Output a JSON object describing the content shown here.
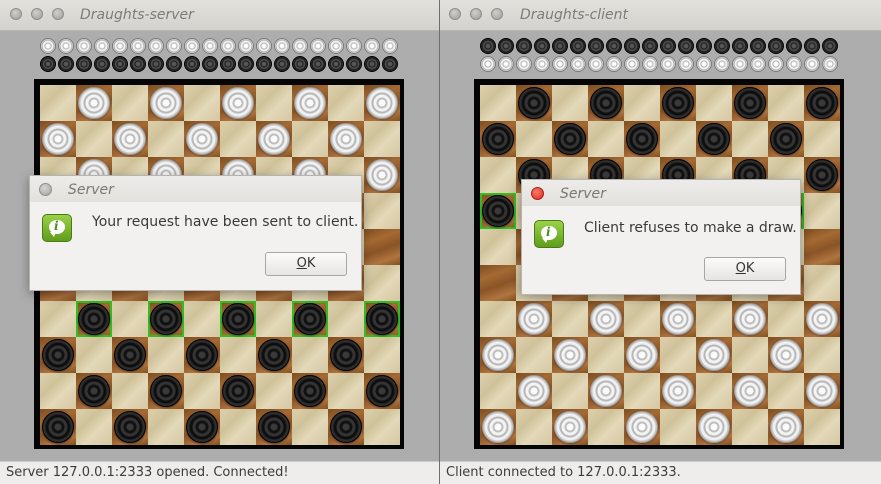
{
  "server_window": {
    "title": "Draughts-server",
    "status": "Server 127.0.0.1:2333 opened. Connected!",
    "captured_rows": [
      [
        "white",
        "white",
        "white",
        "white",
        "white",
        "white",
        "white",
        "white",
        "white",
        "white",
        "white",
        "white",
        "white",
        "white",
        "white",
        "white",
        "white",
        "white",
        "white",
        "white"
      ],
      [
        "black",
        "black",
        "black",
        "black",
        "black",
        "black",
        "black",
        "black",
        "black",
        "black",
        "black",
        "black",
        "black",
        "black",
        "black",
        "black",
        "black",
        "black",
        "black",
        "black"
      ]
    ],
    "board": {
      "pieces": [
        [
          null,
          "white",
          null,
          "white",
          null,
          "white",
          null,
          "white",
          null,
          "white"
        ],
        [
          "white",
          null,
          "white",
          null,
          "white",
          null,
          "white",
          null,
          "white",
          null
        ],
        [
          null,
          "white",
          null,
          "white",
          null,
          "white",
          null,
          "white",
          null,
          "white"
        ],
        [
          null,
          null,
          null,
          null,
          null,
          null,
          null,
          null,
          null,
          null
        ],
        [
          null,
          null,
          null,
          null,
          null,
          null,
          null,
          null,
          null,
          null
        ],
        [
          null,
          null,
          null,
          null,
          null,
          null,
          null,
          null,
          null,
          null
        ],
        [
          null,
          "black",
          null,
          "black",
          null,
          "black",
          null,
          "black",
          null,
          "black"
        ],
        [
          "black",
          null,
          "black",
          null,
          "black",
          null,
          "black",
          null,
          "black",
          null
        ],
        [
          null,
          "black",
          null,
          "black",
          null,
          "black",
          null,
          "black",
          null,
          "black"
        ],
        [
          "black",
          null,
          "black",
          null,
          "black",
          null,
          "black",
          null,
          "black",
          null
        ]
      ],
      "highlighted": [
        [
          6,
          1
        ],
        [
          6,
          3
        ],
        [
          6,
          5
        ],
        [
          6,
          7
        ],
        [
          6,
          9
        ]
      ],
      "dark_first_odd": true
    },
    "dialog": {
      "title": "Server",
      "message": "Your request have been sent to client.",
      "ok_label": "OK",
      "ok_mnemonic": "O",
      "ok_rest": "K"
    }
  },
  "client_window": {
    "title": "Draughts-client",
    "status": "Client connected to 127.0.0.1:2333.",
    "captured_rows": [
      [
        "black",
        "black",
        "black",
        "black",
        "black",
        "black",
        "black",
        "black",
        "black",
        "black",
        "black",
        "black",
        "black",
        "black",
        "black",
        "black",
        "black",
        "black",
        "black",
        "black"
      ],
      [
        "white",
        "white",
        "white",
        "white",
        "white",
        "white",
        "white",
        "white",
        "white",
        "white",
        "white",
        "white",
        "white",
        "white",
        "white",
        "white",
        "white",
        "white",
        "white",
        "white"
      ]
    ],
    "board": {
      "pieces": [
        [
          null,
          "black",
          null,
          "black",
          null,
          "black",
          null,
          "black",
          null,
          "black"
        ],
        [
          "black",
          null,
          "black",
          null,
          "black",
          null,
          "black",
          null,
          "black",
          null
        ],
        [
          null,
          "black",
          null,
          "black",
          null,
          "black",
          null,
          "black",
          null,
          "black"
        ],
        [
          "black",
          null,
          "black",
          null,
          "black",
          null,
          "black",
          null,
          "black",
          null
        ],
        [
          null,
          null,
          null,
          null,
          null,
          null,
          null,
          null,
          null,
          null
        ],
        [
          null,
          null,
          null,
          null,
          null,
          null,
          null,
          null,
          null,
          null
        ],
        [
          null,
          "white",
          null,
          "white",
          null,
          "white",
          null,
          "white",
          null,
          "white"
        ],
        [
          "white",
          null,
          "white",
          null,
          "white",
          null,
          "white",
          null,
          "white",
          null
        ],
        [
          null,
          "white",
          null,
          "white",
          null,
          "white",
          null,
          "white",
          null,
          "white"
        ],
        [
          "white",
          null,
          "white",
          null,
          "white",
          null,
          "white",
          null,
          "white",
          null
        ]
      ],
      "highlighted": [
        [
          3,
          0
        ],
        [
          3,
          8
        ]
      ],
      "dark_first_odd": true
    },
    "dialog": {
      "title": "Server",
      "message": "Client refuses to make a draw.",
      "ok_label": "OK",
      "ok_mnemonic": "O",
      "ok_rest": "K"
    }
  },
  "colors": {
    "highlight": "#2fbf1e",
    "desktop": "#adadae"
  }
}
